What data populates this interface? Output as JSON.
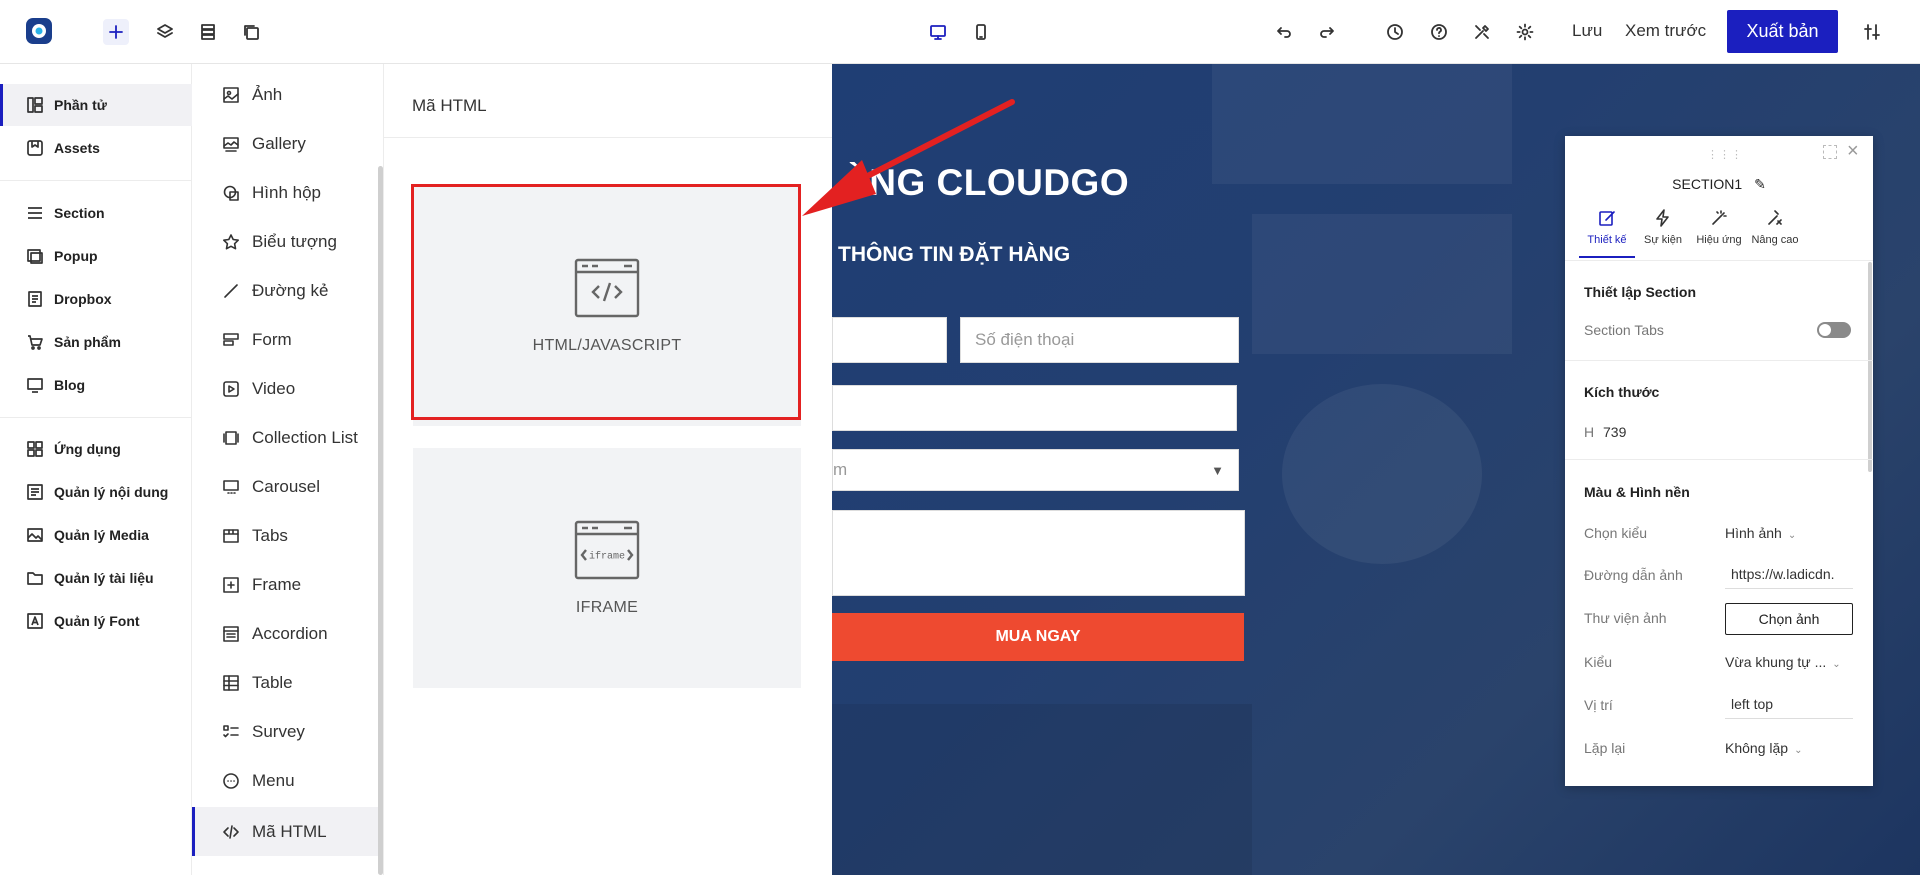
{
  "toolbar": {
    "save": "Lưu",
    "preview": "Xem trước",
    "publish": "Xuất bản"
  },
  "sidebar_main": [
    {
      "label": "Phần tử",
      "icon": "elements-icon"
    },
    {
      "label": "Assets",
      "icon": "assets-icon"
    },
    {
      "label": "Section",
      "icon": "section-icon"
    },
    {
      "label": "Popup",
      "icon": "popup-icon"
    },
    {
      "label": "Dropbox",
      "icon": "dropbox-icon"
    },
    {
      "label": "Sản phẩm",
      "icon": "cart-icon"
    },
    {
      "label": "Blog",
      "icon": "blog-icon"
    },
    {
      "label": "Ứng dụng",
      "icon": "apps-icon"
    },
    {
      "label": "Quản lý nội dung",
      "icon": "content-icon"
    },
    {
      "label": "Quản lý Media",
      "icon": "media-icon"
    },
    {
      "label": "Quản lý tài liệu",
      "icon": "folder-icon"
    },
    {
      "label": "Quản lý Font",
      "icon": "font-icon"
    }
  ],
  "sidebar_elements": [
    {
      "label": "Ảnh",
      "icon": "image-icon"
    },
    {
      "label": "Gallery",
      "icon": "gallery-icon"
    },
    {
      "label": "Hình hộp",
      "icon": "shape-icon"
    },
    {
      "label": "Biểu tượng",
      "icon": "star-icon"
    },
    {
      "label": "Đường kẻ",
      "icon": "line-icon"
    },
    {
      "label": "Form",
      "icon": "form-icon"
    },
    {
      "label": "Video",
      "icon": "video-icon"
    },
    {
      "label": "Collection List",
      "icon": "collection-icon"
    },
    {
      "label": "Carousel",
      "icon": "carousel-icon"
    },
    {
      "label": "Tabs",
      "icon": "tabs-icon"
    },
    {
      "label": "Frame",
      "icon": "frame-icon"
    },
    {
      "label": "Accordion",
      "icon": "accordion-icon"
    },
    {
      "label": "Table",
      "icon": "table-icon"
    },
    {
      "label": "Survey",
      "icon": "survey-icon"
    },
    {
      "label": "Menu",
      "icon": "menu-icon"
    },
    {
      "label": "Mã HTML",
      "icon": "code-icon"
    }
  ],
  "html_panel": {
    "title": "Mã HTML",
    "cards": [
      {
        "label": "HTML/JAVASCRIPT"
      },
      {
        "label": "IFRAME",
        "icon_text": "iframe"
      }
    ]
  },
  "canvas": {
    "title": "ÀNG CLOUDGO",
    "subtitle": "THÔNG TIN ĐẶT HÀNG",
    "phone_placeholder": "Số điện thoại",
    "select_partial": "m",
    "button": "MUA NGAY"
  },
  "properties": {
    "header": "SECTION1",
    "tabs": [
      "Thiết kế",
      "Sự kiện",
      "Hiệu ứng",
      "Nâng cao"
    ],
    "section_setup": "Thiết lập Section",
    "section_tabs": "Section Tabs",
    "size_title": "Kích thước",
    "height_label": "H",
    "height_value": "739",
    "bg_title": "Màu & Hình nền",
    "rows": [
      {
        "label": "Chọn kiểu",
        "value": "Hình ảnh"
      },
      {
        "label": "Đường dẫn ảnh",
        "value": "https://w.ladicdn."
      },
      {
        "label": "Thư viện ảnh",
        "value": "Chọn ảnh"
      },
      {
        "label": "Kiểu",
        "value": "Vừa khung tự ..."
      },
      {
        "label": "Vị trí",
        "value": "left top"
      },
      {
        "label": "Lặp lại",
        "value": "Không lặp"
      }
    ]
  },
  "colors": {
    "accent": "#1b1fbf",
    "highlight": "#e32121",
    "buy_button": "#ee4a30"
  }
}
